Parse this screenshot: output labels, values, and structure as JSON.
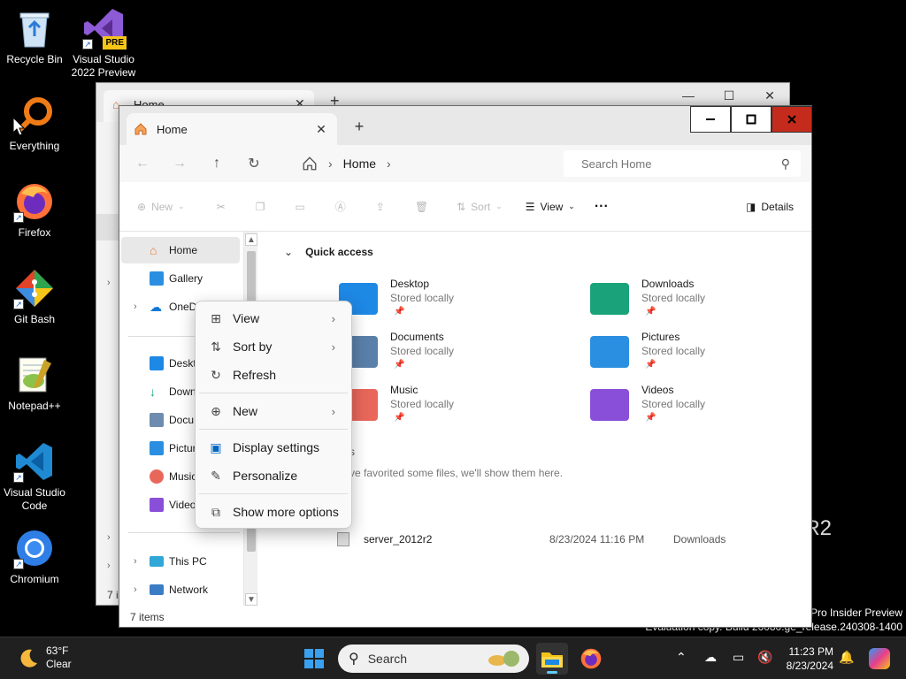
{
  "desktop": {
    "icons": [
      {
        "label_1": "Recycle Bin",
        "label_2": ""
      },
      {
        "label_1": "Visual Studio",
        "label_2": "2022 Preview",
        "badge": "PRE"
      },
      {
        "label_1": "Everything",
        "label_2": ""
      },
      {
        "label_1": "Firefox",
        "label_2": ""
      },
      {
        "label_1": "Git Bash",
        "label_2": ""
      },
      {
        "label_1": "Notepad++",
        "label_2": ""
      },
      {
        "label_1": "Visual Studio",
        "label_2": "Code"
      },
      {
        "label_1": "Chromium",
        "label_2": ""
      }
    ],
    "watermark_line1": "R2",
    "watermark_line2": "Pro Insider Preview",
    "watermark_line3": "Evaluation copy. Build 26080.ge_release.240308-1400"
  },
  "back_window": {
    "tab_title": "Home",
    "status": "7 i"
  },
  "window": {
    "tab_title": "Home",
    "tab_new": "+",
    "address": {
      "crumb": "Home"
    },
    "search": {
      "placeholder": "Search Home"
    },
    "toolbar": {
      "new_label": "New",
      "sort_label": "Sort",
      "view_label": "View",
      "more_label": "···",
      "details_label": "Details"
    },
    "nav": {
      "items": [
        {
          "label": "Home",
          "selected": true
        },
        {
          "label": "Gallery"
        },
        {
          "label": "OneD"
        },
        {
          "label": "Deskt"
        },
        {
          "label": "Down"
        },
        {
          "label": "Docu"
        },
        {
          "label": "Pictur"
        },
        {
          "label": "Music"
        },
        {
          "label": "Video"
        },
        {
          "label": "This PC"
        },
        {
          "label": "Network"
        }
      ]
    },
    "quick_access": {
      "title": "Quick access",
      "tiles": [
        {
          "name": "Desktop",
          "status": "Stored locally",
          "icon": "desktop-folder-icon",
          "color": "#1e88e5"
        },
        {
          "name": "Downloads",
          "status": "Stored locally",
          "icon": "downloads-folder-icon",
          "color": "#1aa37a"
        },
        {
          "name": "Documents",
          "status": "Stored locally",
          "icon": "documents-folder-icon",
          "color": "#5a7fa8"
        },
        {
          "name": "Pictures",
          "status": "Stored locally",
          "icon": "pictures-folder-icon",
          "color": "#2a8fe0"
        },
        {
          "name": "Music",
          "status": "Stored locally",
          "icon": "music-folder-icon",
          "color": "#e8665a"
        },
        {
          "name": "Videos",
          "status": "Stored locally",
          "icon": "videos-folder-icon",
          "color": "#8a4fd8"
        }
      ]
    },
    "favorites_message": "ve favorited some files, we'll show them here.",
    "favorites_partial": "s",
    "recent": [
      {
        "name": "server_2012r2",
        "date": "8/23/2024 11:16 PM",
        "location": "Downloads"
      }
    ],
    "status": "7 items"
  },
  "context_menu": {
    "items": [
      {
        "label": "View",
        "icon": "grid-icon",
        "submenu": true
      },
      {
        "label": "Sort by",
        "icon": "sort-icon",
        "submenu": true
      },
      {
        "label": "Refresh",
        "icon": "refresh-icon",
        "submenu": false
      },
      {
        "label": "New",
        "icon": "plus-circle-icon",
        "submenu": true
      },
      {
        "label": "Display settings",
        "icon": "display-icon",
        "submenu": false
      },
      {
        "label": "Personalize",
        "icon": "pen-icon",
        "submenu": false
      },
      {
        "label": "Show more options",
        "icon": "expand-icon",
        "submenu": false
      }
    ]
  },
  "taskbar": {
    "weather": {
      "temp": "63°F",
      "condition": "Clear"
    },
    "search_label": "Search",
    "clock": {
      "time": "11:23 PM",
      "date": "8/23/2024"
    }
  },
  "colors": {
    "accent": "#0067c0",
    "close_red": "#c42b1c",
    "taskbar": "#202020"
  }
}
